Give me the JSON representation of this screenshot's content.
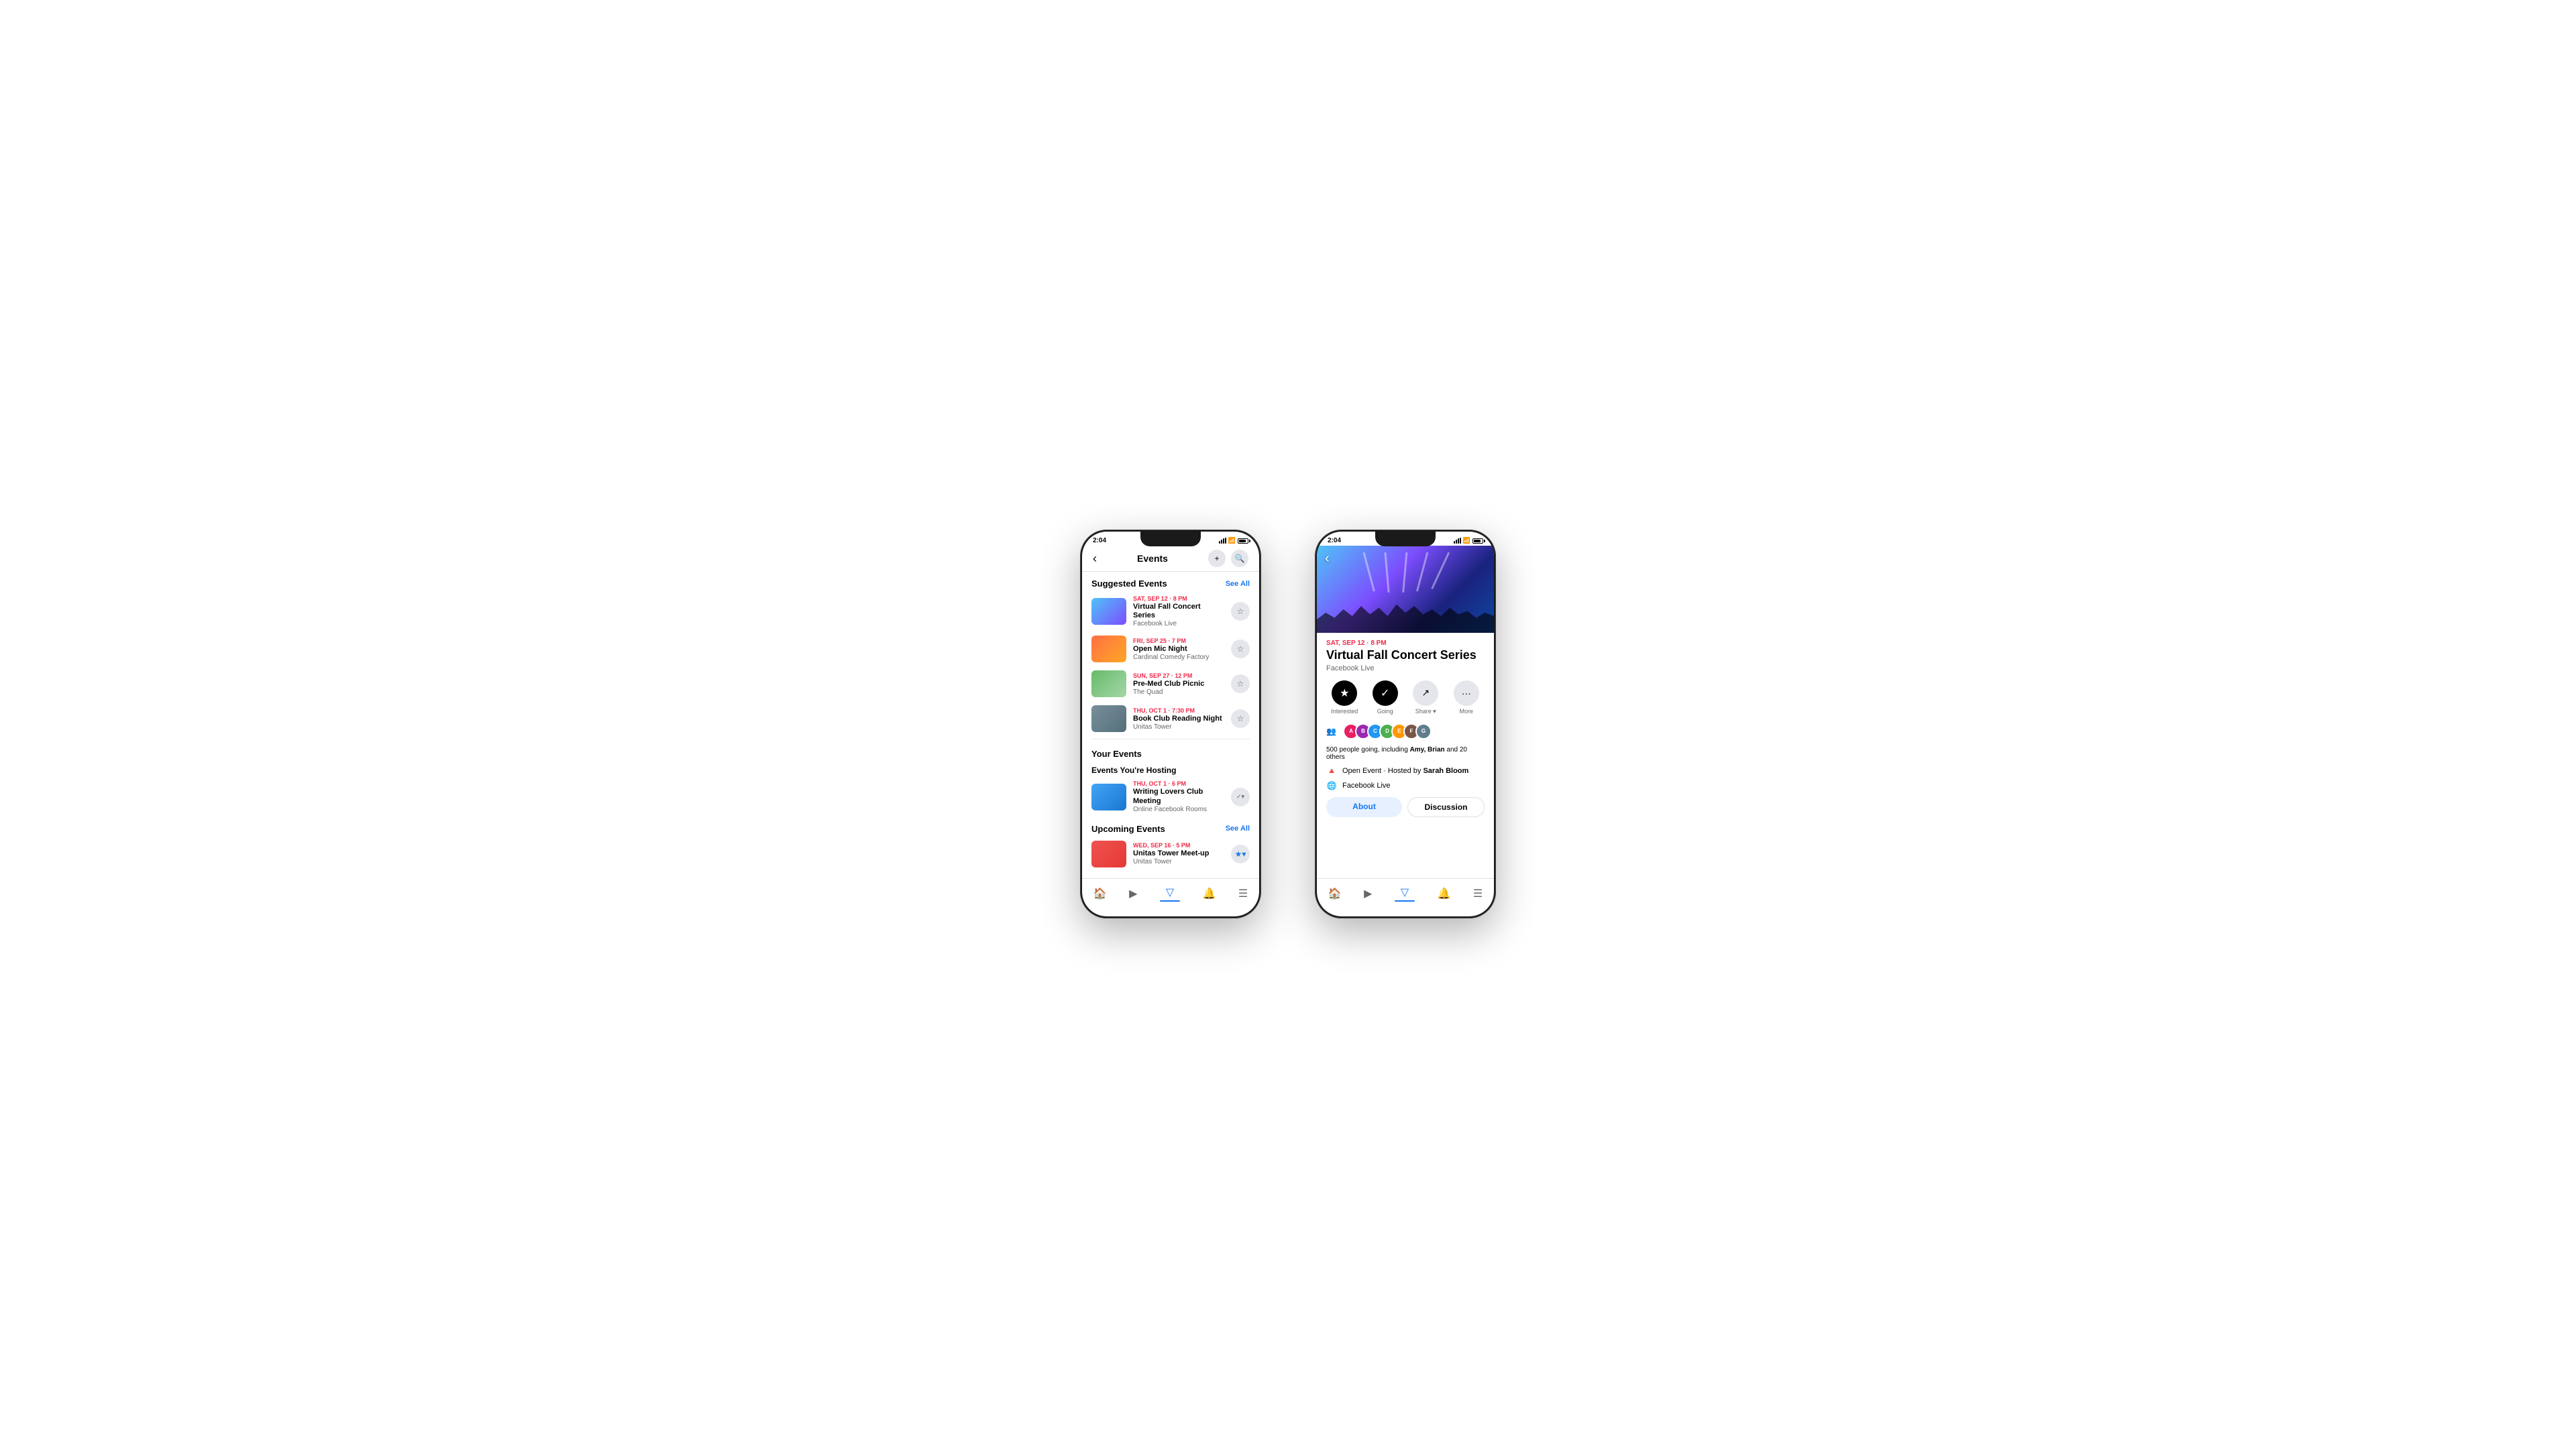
{
  "scene": {
    "background": "#ffffff"
  },
  "phone1": {
    "statusBar": {
      "time": "2:04",
      "signal": "signal",
      "wifi": "wifi",
      "battery": "battery"
    },
    "nav": {
      "title": "Events",
      "backLabel": "‹"
    },
    "suggestedEvents": {
      "sectionTitle": "Suggested Events",
      "seeAll": "See All",
      "items": [
        {
          "date": "SAT, SEP 12 · 8 PM",
          "name": "Virtual Fall Concert Series",
          "location": "Facebook Live",
          "thumbClass": "thumb-concert",
          "starred": false
        },
        {
          "date": "FRI, SEP 25 · 7 PM",
          "name": "Open Mic Night",
          "location": "Cardinal Comedy Factory",
          "thumbClass": "thumb-comedy",
          "starred": false
        },
        {
          "date": "SUN, SEP 27 · 12 PM",
          "name": "Pre-Med Club Picnic",
          "location": "The Quad",
          "thumbClass": "thumb-picnic",
          "starred": false
        },
        {
          "date": "THU, OCT 1 · 7:30 PM",
          "name": "Book Club Reading Night",
          "location": "Unitas Tower",
          "thumbClass": "thumb-book",
          "starred": false
        }
      ]
    },
    "yourEvents": {
      "sectionTitle": "Your Events",
      "hostingTitle": "Events You're Hosting",
      "hostingItems": [
        {
          "date": "THU, OCT 1 · 6 PM",
          "name": "Writing Lovers Club Meeting",
          "location": "Online Facebook Rooms",
          "thumbClass": "thumb-writing"
        }
      ],
      "upcomingTitle": "Upcoming Events",
      "seeAll": "See All",
      "upcomingItems": [
        {
          "date": "WED, SEP 16 · 5 PM",
          "name": "Unitas Tower Meet-up",
          "location": "Unitas Tower",
          "thumbClass": "thumb-unitas",
          "starred": true
        }
      ]
    },
    "tabBar": {
      "items": [
        "🏠",
        "▶",
        "▽",
        "🔔",
        "☰"
      ],
      "activeIndex": 2
    }
  },
  "phone2": {
    "statusBar": {
      "time": "2:04"
    },
    "hero": {
      "backLabel": "‹"
    },
    "event": {
      "date": "SAT, SEP 12 · 8 PM",
      "title": "Virtual Fall Concert Series",
      "host": "Facebook Live",
      "actions": [
        {
          "icon": "★",
          "label": "Interested",
          "dark": true
        },
        {
          "icon": "✓",
          "label": "Going",
          "dark": true
        },
        {
          "icon": "↗",
          "label": "Share ▾",
          "dark": false
        },
        {
          "icon": "···",
          "label": "More",
          "dark": false
        }
      ],
      "attendeesText": "500 people going, including",
      "attendeesNames": "Amy, Brian",
      "attendeesExtra": "and 20 others",
      "avatarColors": [
        "#e91e63",
        "#9c27b0",
        "#2196f3",
        "#4caf50",
        "#ff9800",
        "#795548",
        "#607d8b"
      ],
      "metaRows": [
        {
          "icon": "🔺",
          "text": "Open Event · Hosted by ",
          "bold": "Sarah Bloom"
        },
        {
          "icon": "🌐",
          "text": "Facebook Live",
          "bold": ""
        }
      ],
      "tabs": [
        {
          "label": "About",
          "active": true
        },
        {
          "label": "Discussion",
          "active": false
        }
      ]
    },
    "tabBar": {
      "items": [
        "🏠",
        "▶",
        "▽",
        "🔔",
        "☰"
      ],
      "activeIndex": 2
    }
  }
}
